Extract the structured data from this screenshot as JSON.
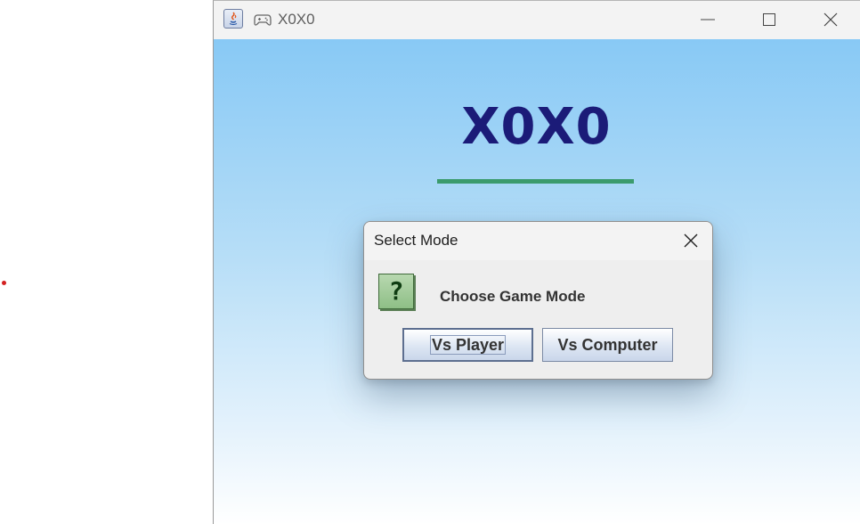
{
  "window": {
    "title": "X0X0",
    "icons": [
      "java-icon",
      "gamepad-icon"
    ],
    "controls": [
      "minimize-icon",
      "maximize-icon",
      "close-icon"
    ]
  },
  "game": {
    "heading": "X0X0",
    "colors": {
      "heading": "#1b1b78",
      "accent_bar": "#3b9b6d",
      "background_top": "#88c9f5",
      "background_bottom": "#ffffff"
    }
  },
  "dialog": {
    "title": "Select Mode",
    "message": "Choose Game Mode",
    "icon": "question-icon",
    "icon_glyph": "?",
    "buttons": {
      "player": "Vs Player",
      "computer": "Vs Computer"
    },
    "focused_button": "Vs Player"
  }
}
